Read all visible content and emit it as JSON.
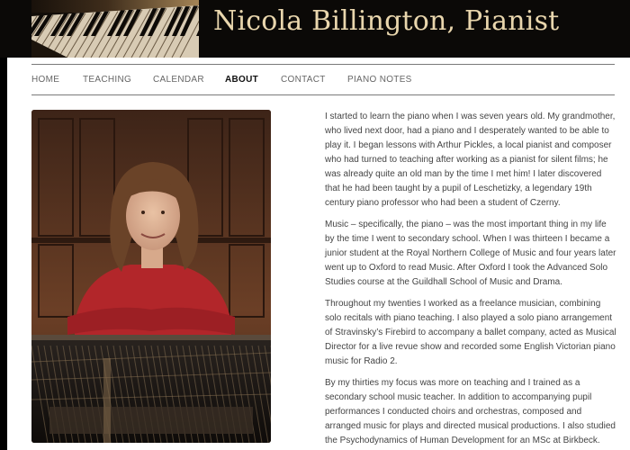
{
  "header": {
    "site_title": "Nicola Billington, Pianist"
  },
  "nav": {
    "items": [
      {
        "label": "HOME",
        "active": false
      },
      {
        "label": "TEACHING",
        "active": false
      },
      {
        "label": "CALENDAR",
        "active": false
      },
      {
        "label": "ABOUT",
        "active": true
      },
      {
        "label": "CONTACT",
        "active": false
      },
      {
        "label": "PIANO NOTES",
        "active": false
      }
    ]
  },
  "about": {
    "paragraphs": [
      "I started to learn the piano when I was seven years old. My grandmother, who lived next door, had a piano and I desperately wanted to be able to play it. I began lessons with Arthur Pickles, a local pianist and composer who had turned to teaching after working as a pianist for silent films; he was already quite an old man by the time I met him! I later discovered that he had been taught by a pupil of Leschetizky, a legendary 19th century piano professor who had been a student of Czerny.",
      "Music – specifically, the piano – was the most important thing in my life by the time I went to secondary school. When I was thirteen I became a junior student at the Royal Northern College of Music and four years later went up to Oxford to read Music. After Oxford I took the Advanced Solo Studies course at the Guildhall School of Music and Drama.",
      "Throughout my twenties I worked as a freelance musician, combining solo recitals with piano teaching. I also played a solo piano arrangement of Stravinsky’s Firebird to accompany a ballet company, acted as Musical Director for a live revue show and recorded some English Victorian piano music for Radio 2.",
      "By my thirties my focus was more on teaching and I trained as a secondary school music teacher. In addition to accompanying pupil performances I conducted choirs and orchestras, composed and arranged music for plays and directed musical productions. I also studied the Psychodynamics of Human Development for an MSc at Birkbeck."
    ]
  },
  "colors": {
    "header_bg": "#0b0907",
    "title_color": "#e9d6ad",
    "nav_active": "#111111",
    "nav_inactive": "#666666",
    "body_text": "#444444"
  }
}
